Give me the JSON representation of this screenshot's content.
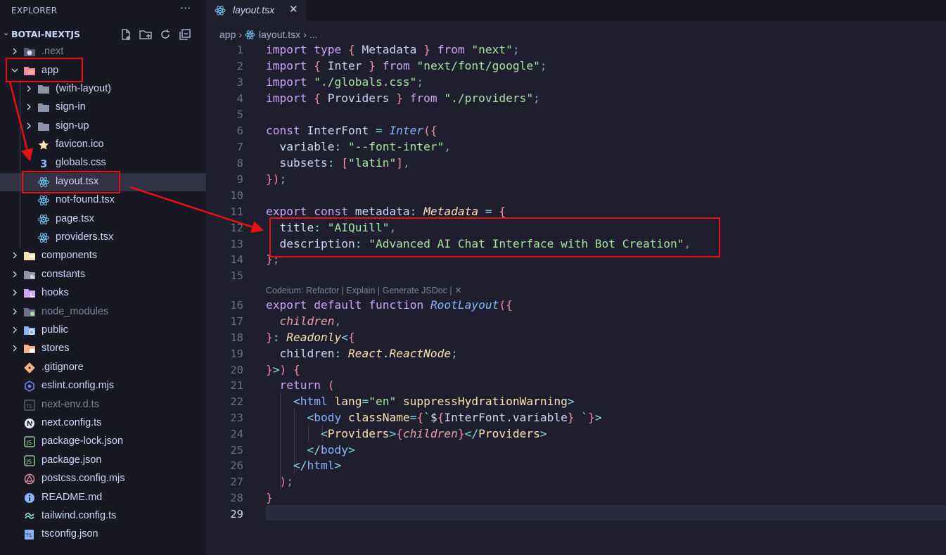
{
  "sidebar": {
    "title": "EXPLORER",
    "more": "···",
    "project": "BOTAI-NEXTJS",
    "items": [
      {
        "label": ".next",
        "icon": "next-folder-icon",
        "dim": true
      },
      {
        "label": "app",
        "icon": "app-folder-icon"
      },
      {
        "label": "(with-layout)",
        "icon": "folder-icon"
      },
      {
        "label": "sign-in",
        "icon": "folder-icon"
      },
      {
        "label": "sign-up",
        "icon": "folder-icon"
      },
      {
        "label": "favicon.ico",
        "icon": "star-icon"
      },
      {
        "label": "globals.css",
        "icon": "css-icon"
      },
      {
        "label": "layout.tsx",
        "icon": "react-icon"
      },
      {
        "label": "not-found.tsx",
        "icon": "react-icon"
      },
      {
        "label": "page.tsx",
        "icon": "react-icon"
      },
      {
        "label": "providers.tsx",
        "icon": "react-icon"
      },
      {
        "label": "components",
        "icon": "components-folder-icon"
      },
      {
        "label": "constants",
        "icon": "constants-folder-icon"
      },
      {
        "label": "hooks",
        "icon": "hooks-folder-icon"
      },
      {
        "label": "node_modules",
        "icon": "node-folder-icon",
        "dim": true
      },
      {
        "label": "public",
        "icon": "public-folder-icon"
      },
      {
        "label": "stores",
        "icon": "stores-folder-icon"
      },
      {
        "label": ".gitignore",
        "icon": "git-icon"
      },
      {
        "label": "eslint.config.mjs",
        "icon": "eslint-icon"
      },
      {
        "label": "next-env.d.ts",
        "icon": "ts-icon",
        "dim": true
      },
      {
        "label": "next.config.ts",
        "icon": "nextjs-icon"
      },
      {
        "label": "package-lock.json",
        "icon": "npm-icon"
      },
      {
        "label": "package.json",
        "icon": "npm-icon"
      },
      {
        "label": "postcss.config.mjs",
        "icon": "postcss-icon"
      },
      {
        "label": "README.md",
        "icon": "info-icon"
      },
      {
        "label": "tailwind.config.ts",
        "icon": "tailwind-icon"
      },
      {
        "label": "tsconfig.json",
        "icon": "tsconfig-icon"
      }
    ]
  },
  "editor": {
    "tab": {
      "label": "layout.tsx",
      "close": "✕"
    },
    "breadcrumb": {
      "folder": "app",
      "file": "layout.tsx",
      "more": "..."
    },
    "codelens": "Codeium: Refactor | Explain | Generate JSDoc | ✕",
    "lines": [
      {
        "n": "1",
        "text": "import type { Metadata } from \"next\";"
      },
      {
        "n": "2",
        "text": "import { Inter } from \"next/font/google\";"
      },
      {
        "n": "3",
        "text": "import \"./globals.css\";"
      },
      {
        "n": "4",
        "text": "import { Providers } from \"./providers\";"
      },
      {
        "n": "5",
        "text": ""
      },
      {
        "n": "6",
        "text": "const InterFont = Inter({"
      },
      {
        "n": "7",
        "text": "  variable: \"--font-inter\","
      },
      {
        "n": "8",
        "text": "  subsets: [\"latin\"],"
      },
      {
        "n": "9",
        "text": "});"
      },
      {
        "n": "10",
        "text": ""
      },
      {
        "n": "11",
        "text": "export const metadata: Metadata = {"
      },
      {
        "n": "12",
        "text": "  title: \"AIQuill\","
      },
      {
        "n": "13",
        "text": "  description: \"Advanced AI Chat Interface with Bot Creation\","
      },
      {
        "n": "14",
        "text": "};"
      },
      {
        "n": "15",
        "text": ""
      },
      {
        "n": "16",
        "text": "export default function RootLayout({"
      },
      {
        "n": "17",
        "text": "  children,"
      },
      {
        "n": "18",
        "text": "}: Readonly<{"
      },
      {
        "n": "19",
        "text": "  children: React.ReactNode;"
      },
      {
        "n": "20",
        "text": "}>) {"
      },
      {
        "n": "21",
        "text": "  return ("
      },
      {
        "n": "22",
        "text": "    <html lang=\"en\" suppressHydrationWarning>"
      },
      {
        "n": "23",
        "text": "      <body className={`${InterFont.variable} `}>"
      },
      {
        "n": "24",
        "text": "        <Providers>{children}</Providers>"
      },
      {
        "n": "25",
        "text": "      </body>"
      },
      {
        "n": "26",
        "text": "    </html>"
      },
      {
        "n": "27",
        "text": "  );"
      },
      {
        "n": "28",
        "text": "}"
      },
      {
        "n": "29",
        "text": ""
      }
    ]
  }
}
